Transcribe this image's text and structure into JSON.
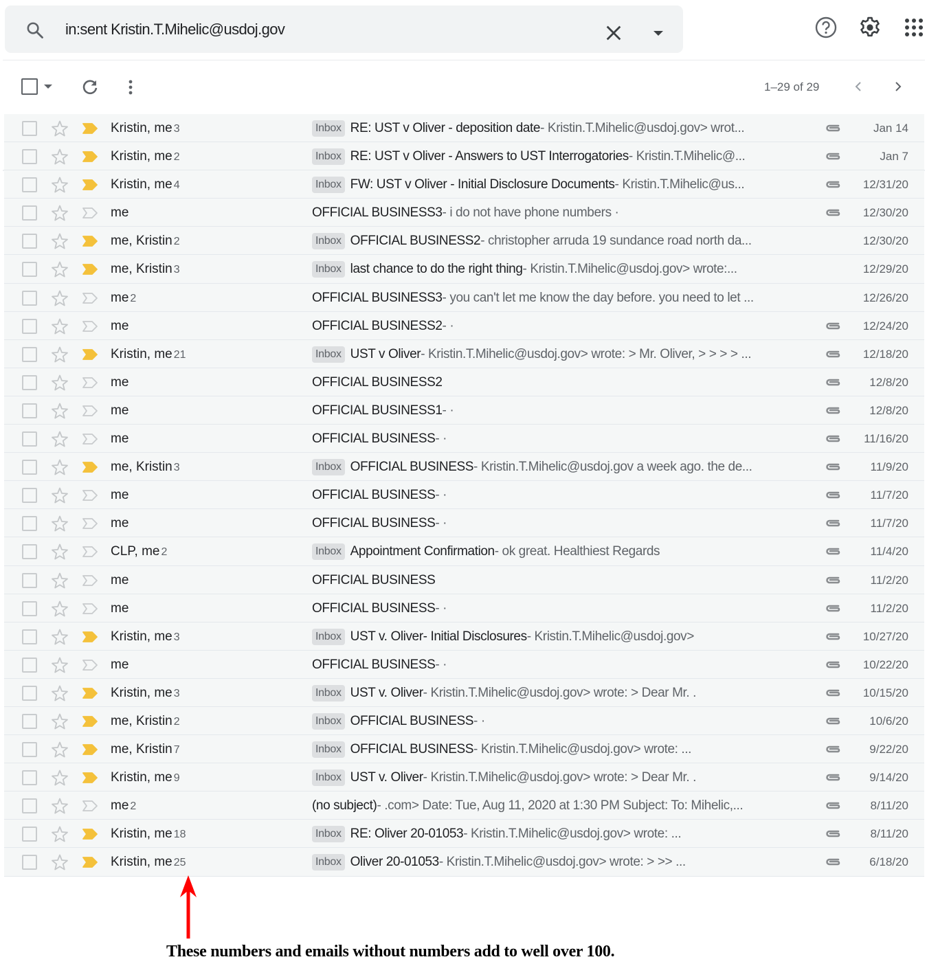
{
  "search": {
    "query": "in:sent Kristin.T.Mihelic@usdoj.gov",
    "icon": "search-icon",
    "clear_icon": "close-icon",
    "options_icon": "caret-down-icon"
  },
  "header_icons": [
    "help-icon",
    "gear-icon",
    "apps-grid-icon"
  ],
  "toolbar": {
    "select_icon": "checkbox-icon",
    "refresh_icon": "refresh-icon",
    "more_icon": "more-vert-icon",
    "count": "1–29 of 29",
    "prev_icon": "chevron-left-icon",
    "next_icon": "chevron-right-icon"
  },
  "colors": {
    "important_marker": "#f4c13b",
    "row_background": "#f5f7f7",
    "badge_background": "#dddfe1",
    "annotation_arrow": "#ff0000"
  },
  "messages": [
    {
      "sender": "Kristin, me",
      "count": "3",
      "important": true,
      "badge": "Inbox",
      "subject": "RE: UST v Oliver - deposition date",
      "snippet": " - Kristin.T.Mihelic@usdoj.gov> wrot...",
      "attachment": true,
      "date": "Jan 14"
    },
    {
      "sender": "Kristin, me",
      "count": "2",
      "important": true,
      "badge": "Inbox",
      "subject": "RE: UST v Oliver - Answers to UST Interrogatories",
      "snippet": " - Kristin.T.Mihelic@...",
      "attachment": true,
      "date": "Jan 7"
    },
    {
      "sender": "Kristin, me",
      "count": "4",
      "important": true,
      "badge": "Inbox",
      "subject": "FW: UST v Oliver - Initial Disclosure Documents",
      "snippet": " - Kristin.T.Mihelic@us...",
      "attachment": true,
      "date": "12/31/20"
    },
    {
      "sender": "me",
      "count": "",
      "important": false,
      "badge": "",
      "subject": "OFFICIAL BUSINESS3",
      "snippet": " - i do not have phone numbers ·",
      "attachment": true,
      "date": "12/30/20"
    },
    {
      "sender": "me, Kristin",
      "count": "2",
      "important": true,
      "badge": "Inbox",
      "subject": "OFFICIAL BUSINESS2",
      "snippet": " - christopher arruda 19 sundance road north da...",
      "attachment": false,
      "date": "12/30/20"
    },
    {
      "sender": "me, Kristin",
      "count": "3",
      "important": true,
      "badge": "Inbox",
      "subject": "last chance to do the right thing",
      "snippet": " - Kristin.T.Mihelic@usdoj.gov> wrote:...",
      "attachment": false,
      "date": "12/29/20"
    },
    {
      "sender": "me",
      "count": "2",
      "important": false,
      "badge": "",
      "subject": "OFFICIAL BUSINESS3",
      "snippet": " - you can't let me know the day before. you need to let ...",
      "attachment": false,
      "date": "12/26/20"
    },
    {
      "sender": "me",
      "count": "",
      "important": false,
      "badge": "",
      "subject": "OFFICIAL BUSINESS2",
      "snippet": " - ·",
      "attachment": true,
      "date": "12/24/20"
    },
    {
      "sender": "Kristin, me",
      "count": "21",
      "important": true,
      "badge": "Inbox",
      "subject": "UST v Oliver",
      "snippet": " - Kristin.T.Mihelic@usdoj.gov> wrote: > Mr. Oliver, > > > > ...",
      "attachment": true,
      "date": "12/18/20"
    },
    {
      "sender": "me",
      "count": "",
      "important": false,
      "badge": "",
      "subject": "OFFICIAL BUSINESS2",
      "snippet": "",
      "attachment": true,
      "date": "12/8/20"
    },
    {
      "sender": "me",
      "count": "",
      "important": false,
      "badge": "",
      "subject": "OFFICIAL BUSINESS1",
      "snippet": " - ·",
      "attachment": true,
      "date": "12/8/20"
    },
    {
      "sender": "me",
      "count": "",
      "important": false,
      "badge": "",
      "subject": "OFFICIAL BUSINESS",
      "snippet": " - ·",
      "attachment": true,
      "date": "11/16/20"
    },
    {
      "sender": "me, Kristin",
      "count": "3",
      "important": true,
      "badge": "Inbox",
      "subject": "OFFICIAL BUSINESS",
      "snippet": " - Kristin.T.Mihelic@usdoj.gov a week ago. the de...",
      "attachment": true,
      "date": "11/9/20"
    },
    {
      "sender": "me",
      "count": "",
      "important": false,
      "badge": "",
      "subject": "OFFICIAL BUSINESS",
      "snippet": " - ·",
      "attachment": true,
      "date": "11/7/20"
    },
    {
      "sender": "me",
      "count": "",
      "important": false,
      "badge": "",
      "subject": "OFFICIAL BUSINESS",
      "snippet": " - ·",
      "attachment": true,
      "date": "11/7/20"
    },
    {
      "sender": "CLP, me",
      "count": "2",
      "important": false,
      "badge": "Inbox",
      "subject": "Appointment Confirmation",
      "snippet": " - ok great. Healthiest Regards",
      "attachment": true,
      "date": "11/4/20"
    },
    {
      "sender": "me",
      "count": "",
      "important": false,
      "badge": "",
      "subject": "OFFICIAL BUSINESS",
      "snippet": "",
      "attachment": true,
      "date": "11/2/20"
    },
    {
      "sender": "me",
      "count": "",
      "important": false,
      "badge": "",
      "subject": "OFFICIAL BUSINESS",
      "snippet": " - ·",
      "attachment": true,
      "date": "11/2/20"
    },
    {
      "sender": "Kristin, me",
      "count": "3",
      "important": true,
      "badge": "Inbox",
      "subject": "UST v. Oliver- Initial Disclosures",
      "snippet": " - Kristin.T.Mihelic@usdoj.gov>",
      "attachment": true,
      "date": "10/27/20"
    },
    {
      "sender": "me",
      "count": "",
      "important": false,
      "badge": "",
      "subject": "OFFICIAL BUSINESS",
      "snippet": " - ·",
      "attachment": true,
      "date": "10/22/20"
    },
    {
      "sender": "Kristin, me",
      "count": "3",
      "important": true,
      "badge": "Inbox",
      "subject": "UST v. Oliver",
      "snippet": " - Kristin.T.Mihelic@usdoj.gov> wrote: > Dear Mr. .",
      "attachment": true,
      "date": "10/15/20"
    },
    {
      "sender": "me, Kristin",
      "count": "2",
      "important": true,
      "badge": "Inbox",
      "subject": "OFFICIAL BUSINESS",
      "snippet": " - ·",
      "attachment": true,
      "date": "10/6/20"
    },
    {
      "sender": "me, Kristin",
      "count": "7",
      "important": true,
      "badge": "Inbox",
      "subject": "OFFICIAL BUSINESS",
      "snippet": " - Kristin.T.Mihelic@usdoj.gov> wrote: ...",
      "attachment": true,
      "date": "9/22/20"
    },
    {
      "sender": "Kristin, me",
      "count": "9",
      "important": true,
      "badge": "Inbox",
      "subject": "UST v. Oliver",
      "snippet": " - Kristin.T.Mihelic@usdoj.gov> wrote: > Dear Mr. .",
      "attachment": true,
      "date": "9/14/20"
    },
    {
      "sender": "me",
      "count": "2",
      "important": false,
      "badge": "",
      "subject": "(no subject)",
      "snippet": " - .com> Date: Tue, Aug 11, 2020 at 1:30 PM Subject: To: Mihelic,...",
      "attachment": true,
      "date": "8/11/20"
    },
    {
      "sender": "Kristin, me",
      "count": "18",
      "important": true,
      "badge": "Inbox",
      "subject": "RE: Oliver 20-01053",
      "snippet": " - Kristin.T.Mihelic@usdoj.gov> wrote: ...",
      "attachment": true,
      "date": "8/11/20"
    },
    {
      "sender": "Kristin, me",
      "count": "25",
      "important": true,
      "badge": "Inbox",
      "subject": "Oliver 20-01053",
      "snippet": " - Kristin.T.Mihelic@usdoj.gov> wrote: > >> ...",
      "attachment": true,
      "date": "6/18/20"
    }
  ],
  "annotation": {
    "arrow_icon": "red-arrow-up-icon",
    "text": "These numbers and emails without numbers add to well over 100."
  }
}
